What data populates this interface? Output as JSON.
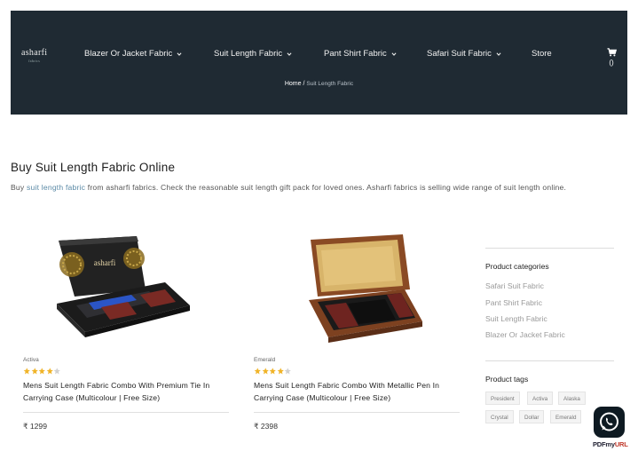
{
  "header": {
    "logo": "asharfi",
    "logo_sub": "fabrics",
    "nav": [
      {
        "label": "Blazer Or Jacket Fabric",
        "has_dropdown": true
      },
      {
        "label": "Suit Length Fabric",
        "has_dropdown": true
      },
      {
        "label": "Pant Shirt Fabric",
        "has_dropdown": true
      },
      {
        "label": "Safari Suit Fabric",
        "has_dropdown": true
      },
      {
        "label": "Store",
        "has_dropdown": false
      }
    ],
    "cart_icon": "cart-icon",
    "cart_count": "()",
    "breadcrumb": {
      "home": "Home",
      "separator": " / ",
      "current": "Suit Length Fabric"
    }
  },
  "main": {
    "title": "Buy Suit Length Fabric Online",
    "intro": {
      "before": "Buy ",
      "link": "suit length fabric",
      "after": " from asharfi fabrics. Check the reasonable suit length gift pack for loved ones. Asharfi fabrics is selling wide range of suit length online."
    },
    "products": [
      {
        "brand": "Activa",
        "rating": 4,
        "rating_max": 5,
        "name": "Mens Suit Length Fabric Combo With Premium Tie In Carrying Case (Multicolour | Free Size)",
        "price": "₹ 1299",
        "image_label": "asharfi"
      },
      {
        "brand": "Emerald",
        "rating": 4,
        "rating_max": 5,
        "name": "Mens Suit Length Fabric Combo With Metallic Pen In Carrying Case (Multicolour | Free Size)",
        "price": "₹ 2398"
      }
    ]
  },
  "sidebar": {
    "categories_heading": "Product categories",
    "categories": [
      "Safari Suit Fabric",
      "Pant Shirt Fabric",
      "Suit Length Fabric",
      "Blazer Or Jacket Fabric"
    ],
    "tags_heading": "Product tags",
    "tags": [
      "President",
      "Activa",
      "Alaska",
      "Crystal",
      "Dollar",
      "Emerald"
    ]
  },
  "floating": {
    "whatsapp_icon": "whatsapp-icon",
    "pdf_brand_a": "PDFmy",
    "pdf_brand_b": "URL"
  },
  "colors": {
    "header_bg": "#1f2a33",
    "link": "#5b8aa6",
    "star": "#f0b429"
  }
}
